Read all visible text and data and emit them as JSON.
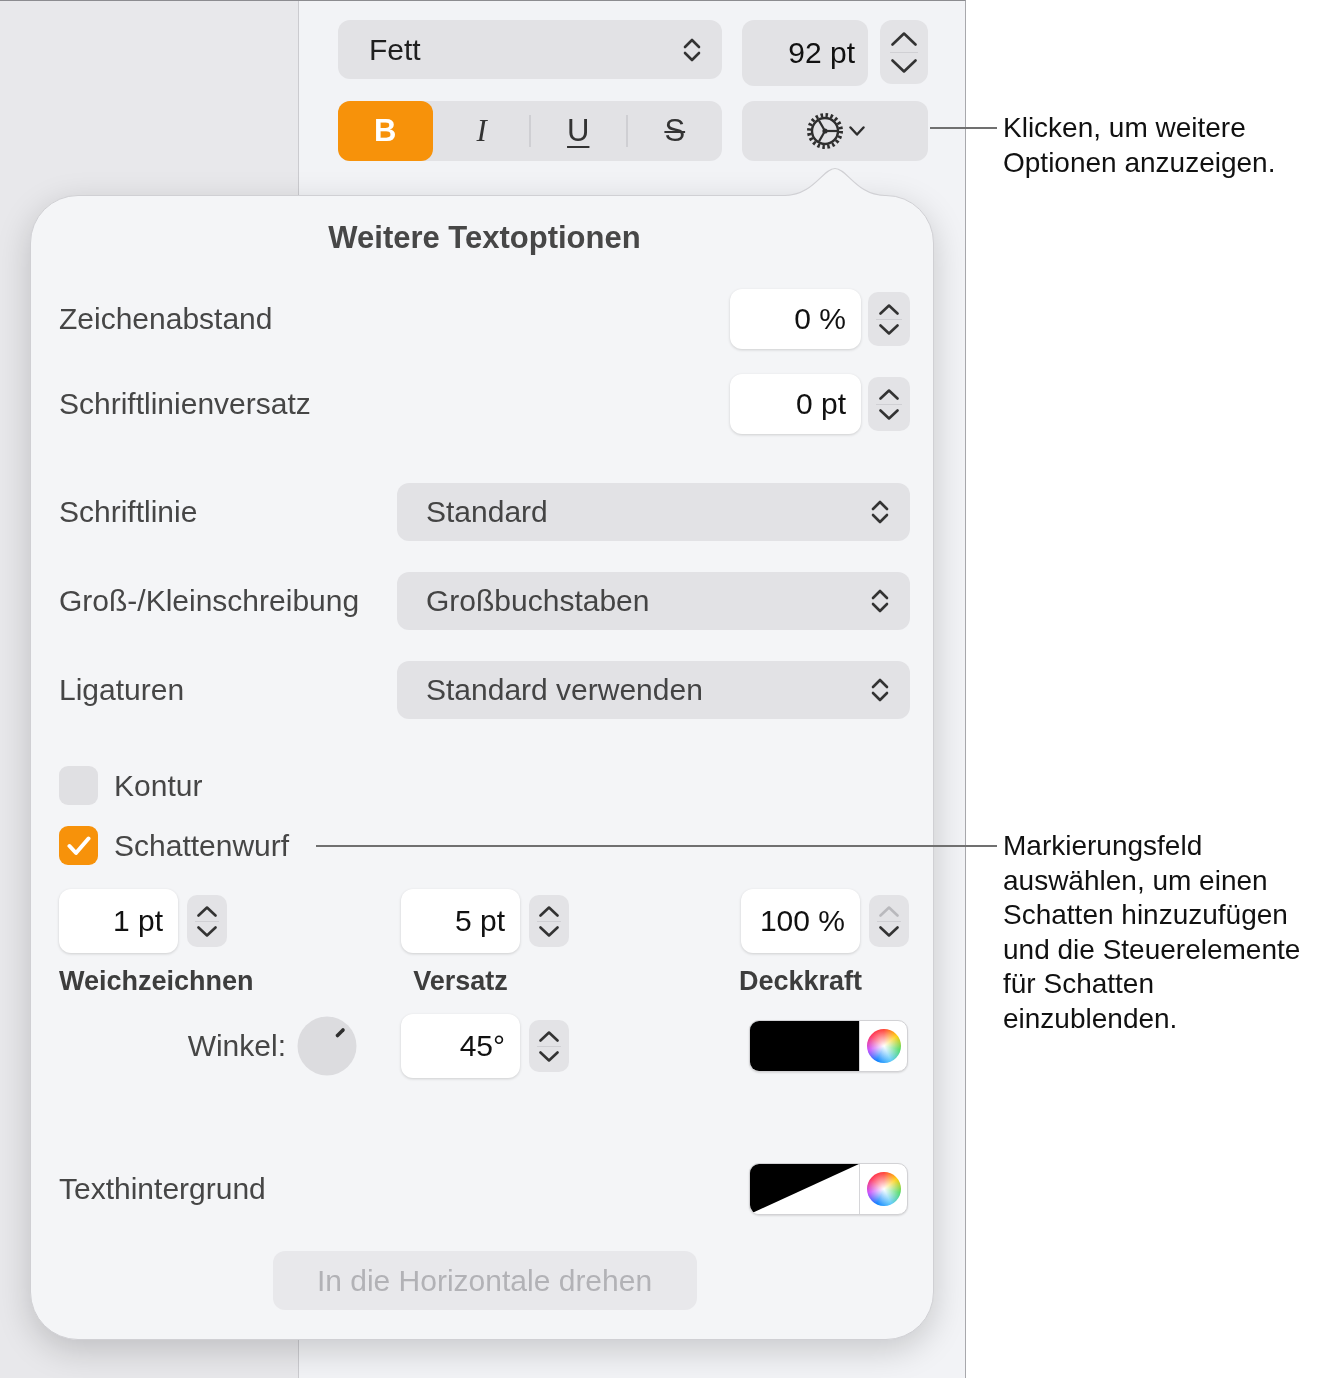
{
  "inspector": {
    "font_style": {
      "value": "Fett"
    },
    "font_size": {
      "value": "92 pt"
    },
    "text_styles": [
      {
        "kind": "bold",
        "label": "B",
        "selected": true
      },
      {
        "kind": "italic",
        "label": "I",
        "selected": false
      },
      {
        "kind": "underline",
        "label": "U",
        "selected": false
      },
      {
        "kind": "strikethrough",
        "label": "S",
        "selected": false
      }
    ]
  },
  "popover": {
    "title": "Weitere Textoptionen",
    "spacing_fields": [
      {
        "label": "Zeichenabstand",
        "value": "0 %"
      },
      {
        "label": "Schriftlinienversatz",
        "value": "0 pt"
      }
    ],
    "popups": [
      {
        "label": "Schriftlinie",
        "value": "Standard"
      },
      {
        "label": "Groß-/Kleinschreibung",
        "value": "Großbuchstaben"
      },
      {
        "label": "Ligaturen",
        "value": "Standard verwenden"
      }
    ],
    "checkboxes": [
      {
        "label": "Kontur",
        "checked": false
      },
      {
        "label": "Schattenwurf",
        "checked": true
      }
    ],
    "shadow": {
      "fields": [
        {
          "label": "Weichzeichnen",
          "value": "1 pt",
          "up_disabled": false
        },
        {
          "label": "Versatz",
          "value": "5 pt",
          "up_disabled": false
        },
        {
          "label": "Deckkraft",
          "value": "100 %",
          "up_disabled": true
        }
      ],
      "angle": {
        "label": "Winkel:",
        "value": "45°"
      },
      "color_well": {
        "kind": "solid",
        "color": "#000000"
      }
    },
    "text_background": {
      "label": "Texthintergrund",
      "color_well": {
        "kind": "none"
      }
    },
    "rotate_button": {
      "label": "In die Horizontale drehen",
      "disabled": true
    }
  },
  "callouts": [
    {
      "text": "Klicken, um weitere Optionen anzuzeigen."
    },
    {
      "text": "Markierungsfeld auswählen, um einen Schatten hinzuzufügen und die Steuerelemente für Schatten einzublenden."
    }
  ]
}
